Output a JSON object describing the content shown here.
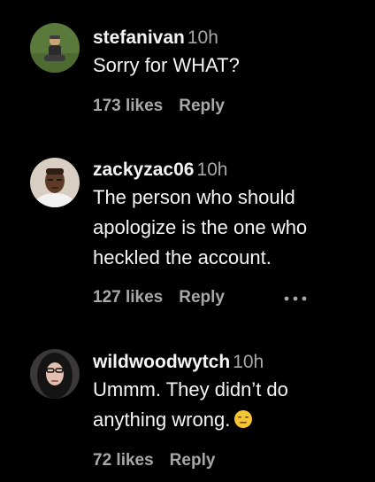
{
  "comments": [
    {
      "username": "stefanivan",
      "time": "10h",
      "text": "Sorry for WHAT?",
      "likes": "173 likes",
      "reply": "Reply",
      "avatar_icon": "avatar-photo-icon"
    },
    {
      "username": "zackyzac06",
      "time": "10h",
      "text_lines": [
        "The person who should",
        "apologize is the one who",
        "heckled the account."
      ],
      "likes": "127 likes",
      "reply": "Reply",
      "more_icon": "more-options-icon",
      "avatar_icon": "avatar-photo-icon"
    },
    {
      "username": "wildwoodwytch",
      "time": "10h",
      "text_lines": [
        "Ummm. They didn’t do",
        "anything wrong."
      ],
      "emoji": "expressionless-face-emoji",
      "likes": "72 likes",
      "reply": "Reply",
      "avatar_icon": "avatar-photo-icon"
    }
  ],
  "colors": {
    "background": "#000000",
    "primary_text": "#f5f5f5",
    "secondary_text": "#a8a8a8"
  }
}
